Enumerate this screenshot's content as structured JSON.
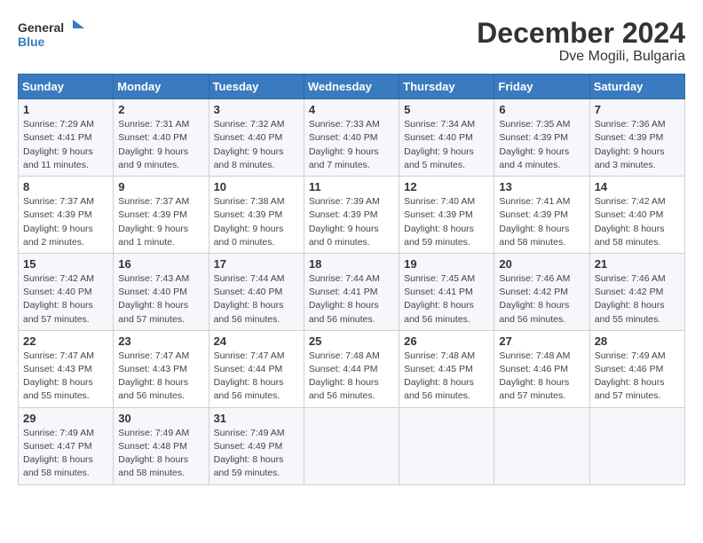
{
  "logo": {
    "line1": "General",
    "line2": "Blue"
  },
  "title": "December 2024",
  "location": "Dve Mogili, Bulgaria",
  "days_of_week": [
    "Sunday",
    "Monday",
    "Tuesday",
    "Wednesday",
    "Thursday",
    "Friday",
    "Saturday"
  ],
  "weeks": [
    [
      {
        "day": "1",
        "info": "Sunrise: 7:29 AM\nSunset: 4:41 PM\nDaylight: 9 hours\nand 11 minutes."
      },
      {
        "day": "2",
        "info": "Sunrise: 7:31 AM\nSunset: 4:40 PM\nDaylight: 9 hours\nand 9 minutes."
      },
      {
        "day": "3",
        "info": "Sunrise: 7:32 AM\nSunset: 4:40 PM\nDaylight: 9 hours\nand 8 minutes."
      },
      {
        "day": "4",
        "info": "Sunrise: 7:33 AM\nSunset: 4:40 PM\nDaylight: 9 hours\nand 7 minutes."
      },
      {
        "day": "5",
        "info": "Sunrise: 7:34 AM\nSunset: 4:40 PM\nDaylight: 9 hours\nand 5 minutes."
      },
      {
        "day": "6",
        "info": "Sunrise: 7:35 AM\nSunset: 4:39 PM\nDaylight: 9 hours\nand 4 minutes."
      },
      {
        "day": "7",
        "info": "Sunrise: 7:36 AM\nSunset: 4:39 PM\nDaylight: 9 hours\nand 3 minutes."
      }
    ],
    [
      {
        "day": "8",
        "info": "Sunrise: 7:37 AM\nSunset: 4:39 PM\nDaylight: 9 hours\nand 2 minutes."
      },
      {
        "day": "9",
        "info": "Sunrise: 7:37 AM\nSunset: 4:39 PM\nDaylight: 9 hours\nand 1 minute."
      },
      {
        "day": "10",
        "info": "Sunrise: 7:38 AM\nSunset: 4:39 PM\nDaylight: 9 hours\nand 0 minutes."
      },
      {
        "day": "11",
        "info": "Sunrise: 7:39 AM\nSunset: 4:39 PM\nDaylight: 9 hours\nand 0 minutes."
      },
      {
        "day": "12",
        "info": "Sunrise: 7:40 AM\nSunset: 4:39 PM\nDaylight: 8 hours\nand 59 minutes."
      },
      {
        "day": "13",
        "info": "Sunrise: 7:41 AM\nSunset: 4:39 PM\nDaylight: 8 hours\nand 58 minutes."
      },
      {
        "day": "14",
        "info": "Sunrise: 7:42 AM\nSunset: 4:40 PM\nDaylight: 8 hours\nand 58 minutes."
      }
    ],
    [
      {
        "day": "15",
        "info": "Sunrise: 7:42 AM\nSunset: 4:40 PM\nDaylight: 8 hours\nand 57 minutes."
      },
      {
        "day": "16",
        "info": "Sunrise: 7:43 AM\nSunset: 4:40 PM\nDaylight: 8 hours\nand 57 minutes."
      },
      {
        "day": "17",
        "info": "Sunrise: 7:44 AM\nSunset: 4:40 PM\nDaylight: 8 hours\nand 56 minutes."
      },
      {
        "day": "18",
        "info": "Sunrise: 7:44 AM\nSunset: 4:41 PM\nDaylight: 8 hours\nand 56 minutes."
      },
      {
        "day": "19",
        "info": "Sunrise: 7:45 AM\nSunset: 4:41 PM\nDaylight: 8 hours\nand 56 minutes."
      },
      {
        "day": "20",
        "info": "Sunrise: 7:46 AM\nSunset: 4:42 PM\nDaylight: 8 hours\nand 56 minutes."
      },
      {
        "day": "21",
        "info": "Sunrise: 7:46 AM\nSunset: 4:42 PM\nDaylight: 8 hours\nand 55 minutes."
      }
    ],
    [
      {
        "day": "22",
        "info": "Sunrise: 7:47 AM\nSunset: 4:43 PM\nDaylight: 8 hours\nand 55 minutes."
      },
      {
        "day": "23",
        "info": "Sunrise: 7:47 AM\nSunset: 4:43 PM\nDaylight: 8 hours\nand 56 minutes."
      },
      {
        "day": "24",
        "info": "Sunrise: 7:47 AM\nSunset: 4:44 PM\nDaylight: 8 hours\nand 56 minutes."
      },
      {
        "day": "25",
        "info": "Sunrise: 7:48 AM\nSunset: 4:44 PM\nDaylight: 8 hours\nand 56 minutes."
      },
      {
        "day": "26",
        "info": "Sunrise: 7:48 AM\nSunset: 4:45 PM\nDaylight: 8 hours\nand 56 minutes."
      },
      {
        "day": "27",
        "info": "Sunrise: 7:48 AM\nSunset: 4:46 PM\nDaylight: 8 hours\nand 57 minutes."
      },
      {
        "day": "28",
        "info": "Sunrise: 7:49 AM\nSunset: 4:46 PM\nDaylight: 8 hours\nand 57 minutes."
      }
    ],
    [
      {
        "day": "29",
        "info": "Sunrise: 7:49 AM\nSunset: 4:47 PM\nDaylight: 8 hours\nand 58 minutes."
      },
      {
        "day": "30",
        "info": "Sunrise: 7:49 AM\nSunset: 4:48 PM\nDaylight: 8 hours\nand 58 minutes."
      },
      {
        "day": "31",
        "info": "Sunrise: 7:49 AM\nSunset: 4:49 PM\nDaylight: 8 hours\nand 59 minutes."
      },
      null,
      null,
      null,
      null
    ]
  ]
}
